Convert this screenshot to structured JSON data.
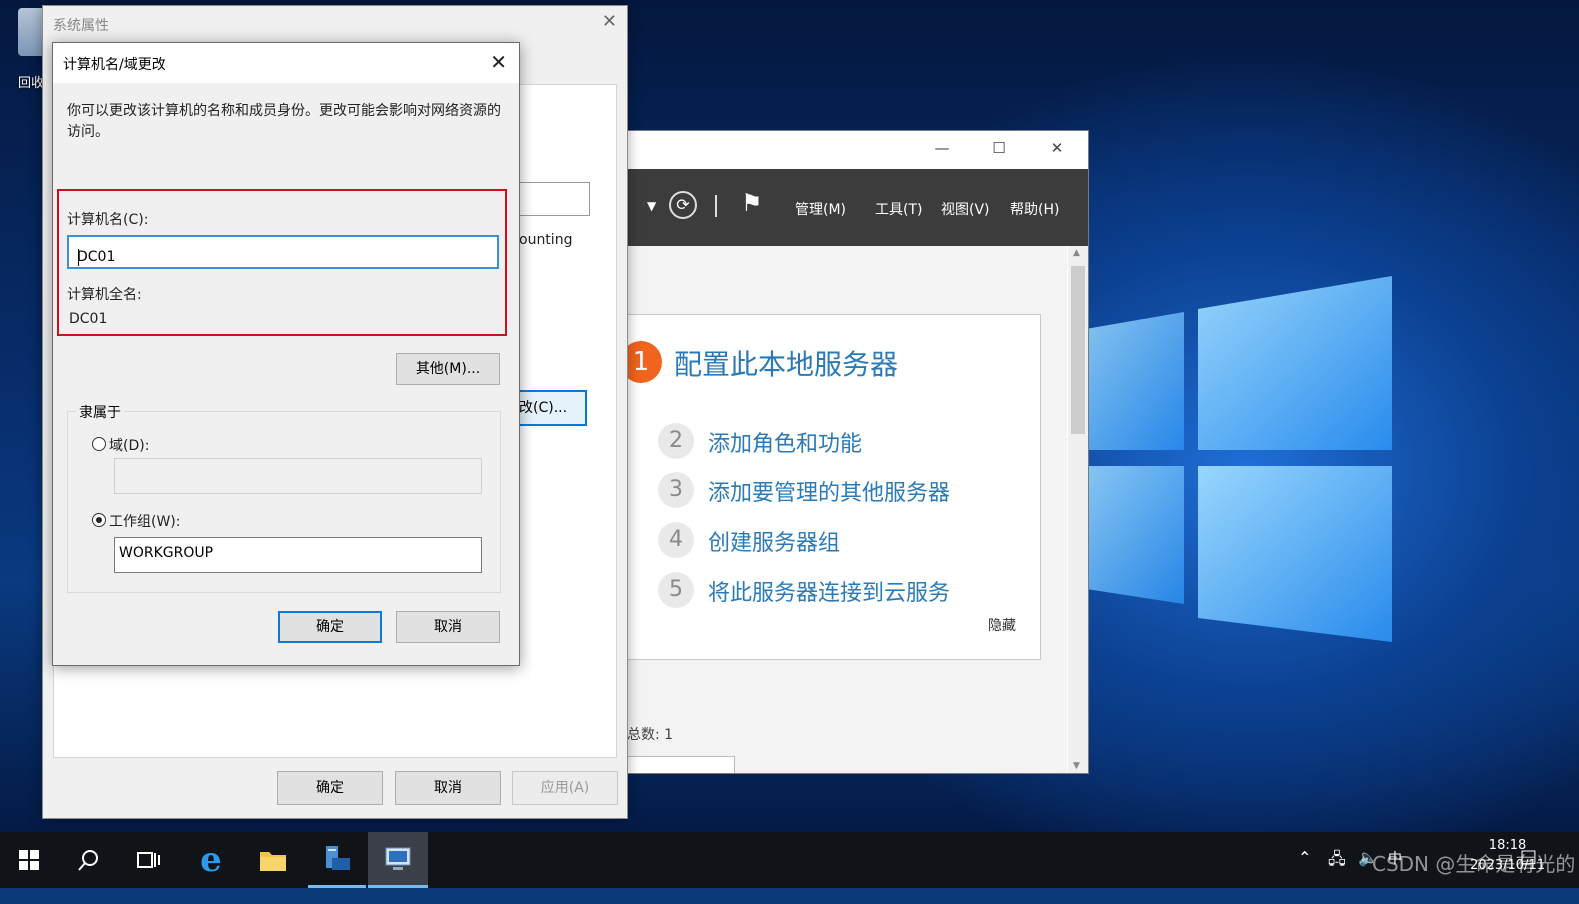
{
  "desktop": {
    "recycle_bin_label": "回收站"
  },
  "server_manager": {
    "menu": {
      "manage": "管理(M)",
      "tools": "工具(T)",
      "view": "视图(V)",
      "help": "帮助(H)"
    },
    "quick_start": {
      "step1_number": "1",
      "step1_title": "配置此本地服务器",
      "items": [
        {
          "number": "2",
          "label": "添加角色和功能"
        },
        {
          "number": "3",
          "label": "添加要管理的其他服务器"
        },
        {
          "number": "4",
          "label": "创建服务器组"
        },
        {
          "number": "5",
          "label": "将此服务器连接到云服务"
        }
      ],
      "hide_label": "隐藏"
    },
    "total_label": "总数: 1"
  },
  "system_properties": {
    "title": "系统属性",
    "peek_text": "ounting",
    "peek_button": "改(C)...",
    "ok": "确定",
    "cancel": "取消",
    "apply": "应用(A)"
  },
  "computer_name_dialog": {
    "title": "计算机名/域更改",
    "description": "你可以更改该计算机的名称和成员身份。更改可能会影响对网络资源的访问。",
    "computer_name_label": "计算机名(C):",
    "computer_name_value": "DC01",
    "full_name_label": "计算机全名:",
    "full_name_value": "DC01",
    "more_button": "其他(M)...",
    "member_of_label": "隶属于",
    "domain_label": "域(D):",
    "domain_value": "",
    "workgroup_label": "工作组(W):",
    "workgroup_value": "WORKGROUP",
    "selected_membership": "workgroup",
    "ok": "确定",
    "cancel": "取消"
  },
  "taskbar": {
    "time": "18:18",
    "date": "2023/10/11",
    "ime": "中",
    "watermark": "CSDN @生命是有光的"
  },
  "colors": {
    "accent_blue": "#2a7ab8",
    "highlight_red": "#d0101a",
    "step1_orange": "#f0641e",
    "focus_blue": "#0a78d7"
  }
}
